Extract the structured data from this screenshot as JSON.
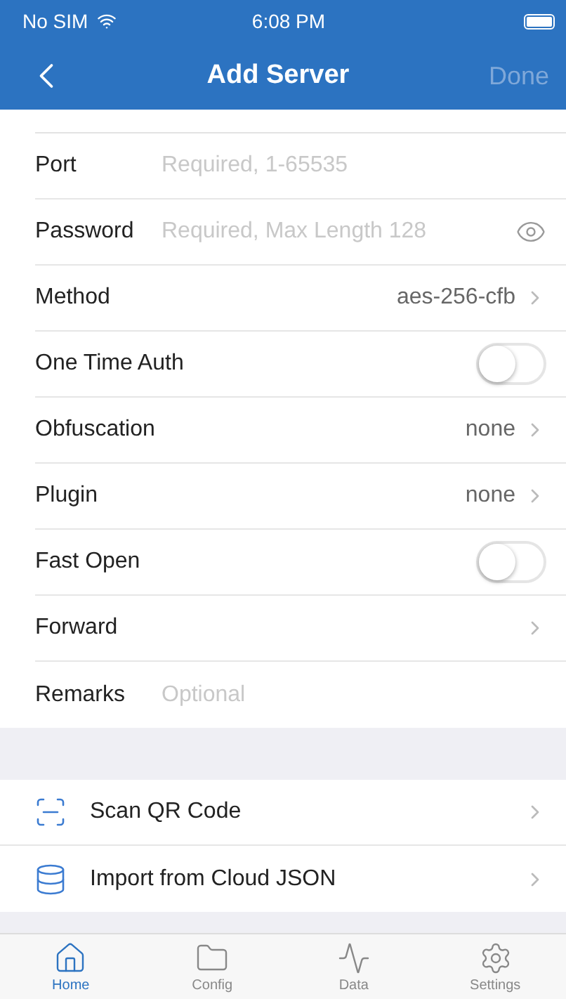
{
  "status_bar": {
    "carrier": "No SIM",
    "time": "6:08 PM"
  },
  "nav": {
    "title": "Add Server",
    "action": "Done",
    "action_disabled": true
  },
  "fields": [
    {
      "kind": "input",
      "label": "Port",
      "placeholder": "Required, 1-65535"
    },
    {
      "kind": "secret",
      "label": "Password",
      "placeholder": "Required, Max Length 128"
    },
    {
      "kind": "select",
      "label": "Method",
      "value": "aes-256-cfb"
    },
    {
      "kind": "toggle",
      "label": "One Time Auth",
      "on": false
    },
    {
      "kind": "select",
      "label": "Obfuscation",
      "value": "none"
    },
    {
      "kind": "select",
      "label": "Plugin",
      "value": "none"
    },
    {
      "kind": "toggle",
      "label": "Fast Open",
      "on": false
    },
    {
      "kind": "select",
      "label": "Forward"
    },
    {
      "kind": "input",
      "label": "Remarks",
      "placeholder": "Optional"
    }
  ],
  "actions": [
    {
      "kind": "scan",
      "label": "Scan QR Code"
    },
    {
      "kind": "import",
      "label": "Import from Cloud JSON"
    }
  ],
  "tabs": [
    {
      "kind": "home",
      "label": "Home",
      "selected": true
    },
    {
      "kind": "config",
      "label": "Config",
      "selected": false
    },
    {
      "kind": "data",
      "label": "Data",
      "selected": false
    },
    {
      "kind": "settings",
      "label": "Settings",
      "selected": false
    }
  ]
}
